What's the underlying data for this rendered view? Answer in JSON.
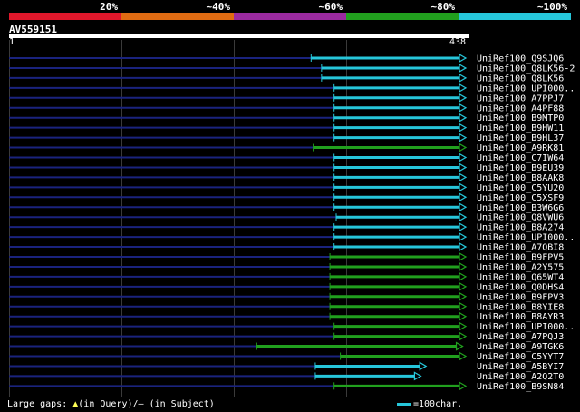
{
  "query": {
    "id": "AV559151",
    "start_tick": "1",
    "end_tick": "438",
    "length": 438
  },
  "identity_legend": [
    {
      "label": "20%",
      "color": "#e0172b"
    },
    {
      "label": "~40%",
      "color": "#e06b12"
    },
    {
      "label": "~60%",
      "color": "#9b2aa0"
    },
    {
      "label": "~80%",
      "color": "#21a01e"
    },
    {
      "label": "~100%",
      "color": "#26c6da"
    }
  ],
  "colors": {
    "cyan": "#26c6da",
    "green": "#21a01e",
    "navy": "#1a237e"
  },
  "hits": [
    {
      "label": "UniRef100_Q9SJQ6",
      "start": 290,
      "end": 438,
      "color": "cyan"
    },
    {
      "label": "UniRef100_Q8LK56-2",
      "start": 300,
      "end": 438,
      "color": "cyan"
    },
    {
      "label": "UniRef100_Q8LK56",
      "start": 300,
      "end": 438,
      "color": "cyan"
    },
    {
      "label": "UniRef100_UPI000..",
      "start": 312,
      "end": 438,
      "color": "cyan"
    },
    {
      "label": "UniRef100_A7PPJ7",
      "start": 312,
      "end": 438,
      "color": "cyan"
    },
    {
      "label": "UniRef100_A4PF88",
      "start": 312,
      "end": 438,
      "color": "cyan"
    },
    {
      "label": "UniRef100_B9MTP0",
      "start": 312,
      "end": 438,
      "color": "cyan"
    },
    {
      "label": "UniRef100_B9HW11",
      "start": 312,
      "end": 438,
      "color": "cyan"
    },
    {
      "label": "UniRef100_B9HL37",
      "start": 312,
      "end": 438,
      "color": "cyan"
    },
    {
      "label": "UniRef100_A9RK81",
      "start": 292,
      "end": 438,
      "color": "green"
    },
    {
      "label": "UniRef100_C7IW64",
      "start": 312,
      "end": 438,
      "color": "cyan"
    },
    {
      "label": "UniRef100_B9EU39",
      "start": 312,
      "end": 438,
      "color": "cyan"
    },
    {
      "label": "UniRef100_B8AAK8",
      "start": 312,
      "end": 438,
      "color": "cyan"
    },
    {
      "label": "UniRef100_C5YU20",
      "start": 312,
      "end": 438,
      "color": "cyan"
    },
    {
      "label": "UniRef100_C5XSF9",
      "start": 312,
      "end": 438,
      "color": "cyan"
    },
    {
      "label": "UniRef100_B3W6G6",
      "start": 312,
      "end": 438,
      "color": "cyan"
    },
    {
      "label": "UniRef100_Q8VWU6",
      "start": 314,
      "end": 438,
      "color": "cyan"
    },
    {
      "label": "UniRef100_B8A274",
      "start": 312,
      "end": 438,
      "color": "cyan"
    },
    {
      "label": "UniRef100_UPI000..",
      "start": 312,
      "end": 438,
      "color": "cyan"
    },
    {
      "label": "UniRef100_A7QBI8",
      "start": 312,
      "end": 438,
      "color": "cyan"
    },
    {
      "label": "UniRef100_B9FPV5",
      "start": 308,
      "end": 438,
      "color": "green"
    },
    {
      "label": "UniRef100_A2Y575",
      "start": 308,
      "end": 438,
      "color": "green"
    },
    {
      "label": "UniRef100_Q65WT4",
      "start": 308,
      "end": 438,
      "color": "green"
    },
    {
      "label": "UniRef100_Q0DHS4",
      "start": 308,
      "end": 438,
      "color": "green"
    },
    {
      "label": "UniRef100_B9FPV3",
      "start": 308,
      "end": 438,
      "color": "green"
    },
    {
      "label": "UniRef100_B8YIE8",
      "start": 308,
      "end": 438,
      "color": "green"
    },
    {
      "label": "UniRef100_B8AYR3",
      "start": 308,
      "end": 438,
      "color": "green"
    },
    {
      "label": "UniRef100_UPI000..",
      "start": 312,
      "end": 438,
      "color": "green"
    },
    {
      "label": "UniRef100_A7PQJ3",
      "start": 312,
      "end": 438,
      "color": "green"
    },
    {
      "label": "UniRef100_A9TGK6",
      "start": 238,
      "end": 435,
      "color": "green"
    },
    {
      "label": "UniRef100_C5YYT7",
      "start": 318,
      "end": 438,
      "color": "green"
    },
    {
      "label": "UniRef100_A5BYI7",
      "start": 294,
      "end": 400,
      "color": "cyan"
    },
    {
      "label": "UniRef100_A2Q2T0",
      "start": 294,
      "end": 395,
      "color": "cyan"
    },
    {
      "label": "UniRef100_B9SN84",
      "start": 312,
      "end": 438,
      "color": "green"
    }
  ],
  "footer": {
    "gaps_prefix": "Large gaps: ",
    "gap_query_mark": "▲",
    "gaps_query": "(in Query)/",
    "gap_subject_mark": "–",
    "gaps_subject": " (in Subject)",
    "scale_label": "=100char."
  }
}
